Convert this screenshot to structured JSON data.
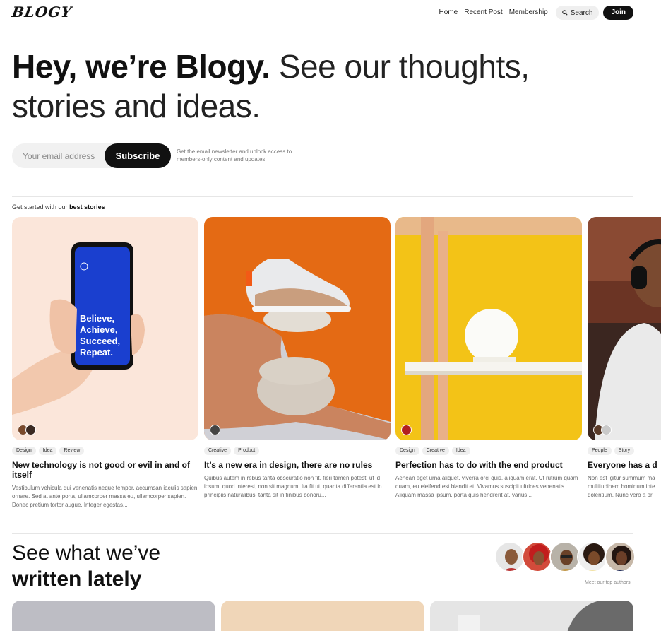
{
  "nav": {
    "logo": "BLOGY",
    "links": [
      "Home",
      "Recent Post",
      "Membership"
    ],
    "search_label": "Search",
    "join_label": "Join"
  },
  "hero": {
    "bold": "Hey, we’re Blogy.",
    "light": "See our thoughts, stories and ideas."
  },
  "subscribe": {
    "placeholder": "Your email address",
    "button": "Subscribe",
    "note": "Get the email newsletter and unlock access to members-only content and updates"
  },
  "best": {
    "prefix": "Get started with our",
    "bold": "best stories"
  },
  "cards": [
    {
      "tags": [
        "Design",
        "Idea",
        "Review"
      ],
      "title": "New technology is not good or evil in and of itself",
      "excerpt": "Vestibulum vehicula dui venenatis neque tempor, accumsan iaculis sapien ornare. Sed at ante porta, ullamcorper massa eu, ullamcorper sapien. Donec pretium tortor augue. Integer egestas...",
      "phone_text": "Believe, Achieve, Succeed, Repeat."
    },
    {
      "tags": [
        "Creative",
        "Product"
      ],
      "title": "It’s a new era in design, there are no rules",
      "excerpt": "Quibus autem in rebus tanta obscuratio non fit, fieri tamen potest, ut id ipsum, quod interest, non sit magnum. Ita fit ut, quanta differentia est in principiis naturalibus, tanta sit in finibus bonoru..."
    },
    {
      "tags": [
        "Design",
        "Creative",
        "Idea"
      ],
      "title": "Perfection has to do with the end product",
      "excerpt": "Aenean eget urna aliquet, viverra orci quis, aliquam erat. Ut rutrum quam quam, eu eleifend est blandit et. Vivamus suscipit ultrices venenatis. Aliquam massa ipsum, porta quis hendrerit at, varius..."
    },
    {
      "tags": [
        "People",
        "Story"
      ],
      "title": "Everyone has a d",
      "excerpt": "Non est igitur summum ma multitudinem hominum inte dolentium. Nunc vero a pri"
    }
  ],
  "latest": {
    "line1": "See what we’ve",
    "line2": "written lately",
    "authors_label": "Meet our top authors"
  },
  "colors": {
    "accent": "#111111",
    "card1_bg": "#fbe3d6",
    "card2_bg": "#e46a14",
    "card3_bg": "#f3c317",
    "phone_screen": "#1a3fcf"
  }
}
